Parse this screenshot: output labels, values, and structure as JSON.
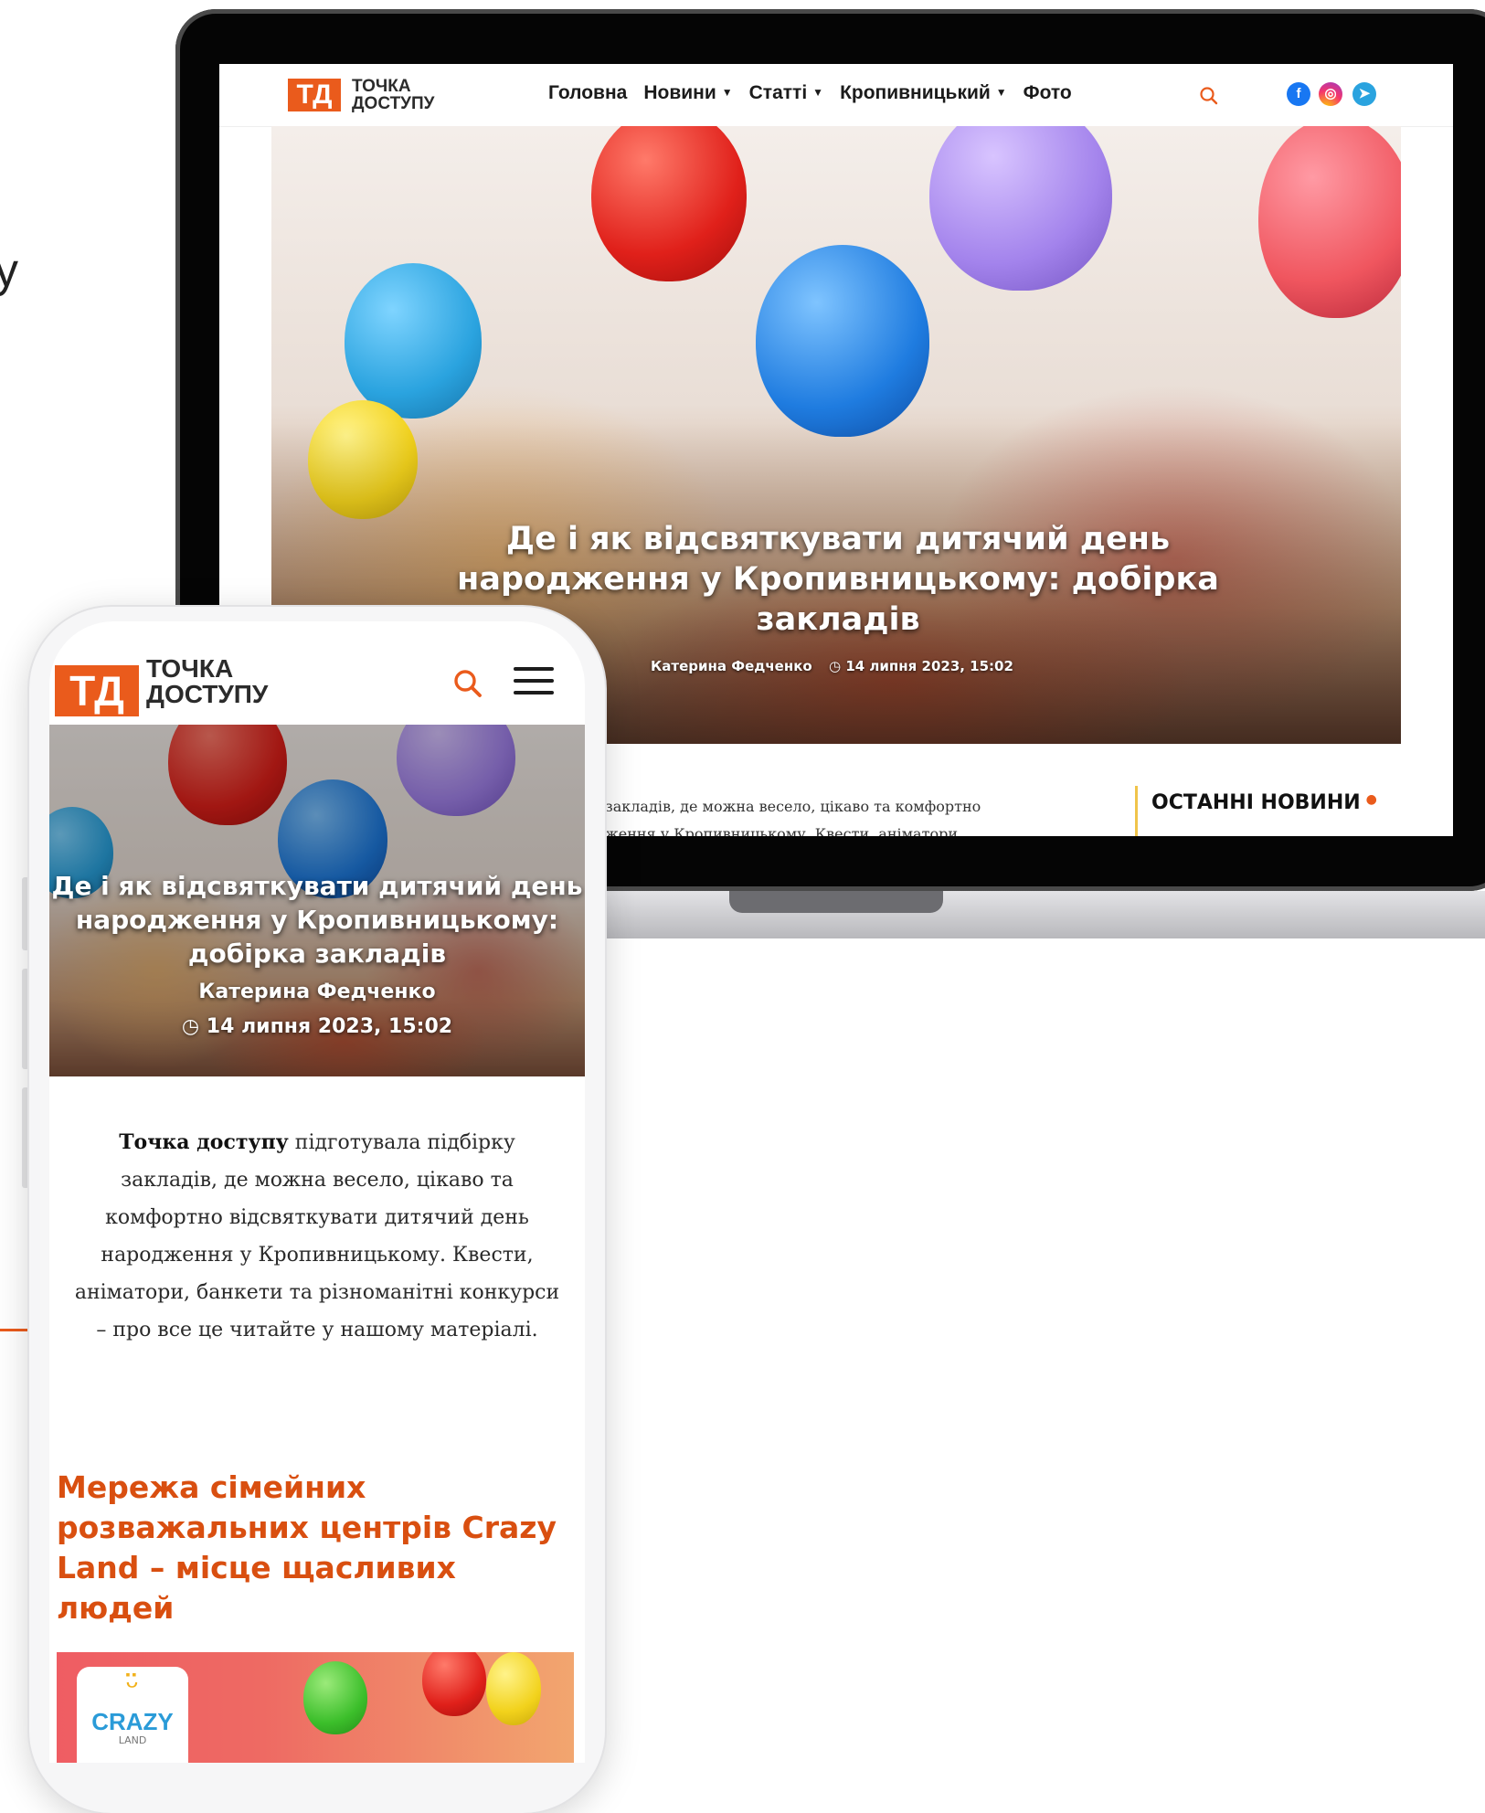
{
  "brand": {
    "logo_mark": "ТД",
    "logo_line1": "ТОЧКА",
    "logo_line2": "ДОСТУПУ",
    "accent_color": "#ea5b1c"
  },
  "desktop": {
    "nav": [
      {
        "label": "Головна",
        "has_dropdown": false
      },
      {
        "label": "Новини",
        "has_dropdown": true
      },
      {
        "label": "Статті",
        "has_dropdown": true
      },
      {
        "label": "Кропивницький",
        "has_dropdown": true
      },
      {
        "label": "Фото",
        "has_dropdown": false
      }
    ],
    "icons": {
      "search": "search-icon",
      "facebook": "facebook-icon",
      "instagram": "instagram-icon",
      "telegram": "telegram-icon"
    },
    "social_glyphs": {
      "facebook": "f",
      "instagram": "◎",
      "telegram": "➤"
    },
    "hero": {
      "title": "Де і як відсвяткувати дитячий день народження у Кропивницькому: добірка закладів",
      "author": "Катерина Федченко",
      "date": "14 липня 2023, 15:02"
    },
    "body_line1": "закладів, де можна весело, цікаво та комфортно",
    "body_line2": "ження у Кропивницькому. Квести, аніматори,",
    "sidebar_title": "ОСТАННІ НОВИНИ"
  },
  "mobile": {
    "hero": {
      "title": "Де і як відсвяткувати дитячий день народження у Кропивницькому: добірка закладів",
      "author": "Катерина Федченко",
      "date": "14 липня 2023, 15:02"
    },
    "lead_bold": "Точка доступу",
    "lead_rest": " підготувала підбірку закладів, де можна весело, цікаво та комфортно відсвяткувати дитячий день народження у Кропивницькому. Квести, аніматори, банкети та різноманітні конкурси – про все це читайте у нашому матеріалі.",
    "section_title": "Мережа сімейних розважальних центрів Crazy Land – місце щасливих людей",
    "banner": {
      "logo_name": "CRAZY",
      "logo_sub": "LAND"
    }
  }
}
